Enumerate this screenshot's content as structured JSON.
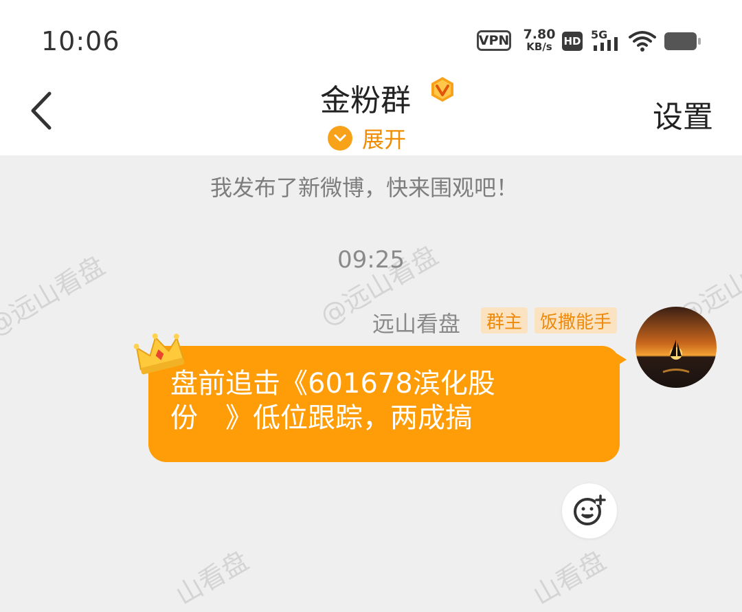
{
  "status_bar": {
    "time": "10:06",
    "vpn": "VPN",
    "net_speed_value": "7.80",
    "net_speed_unit": "KB/s",
    "hd": "HD",
    "network": "5G",
    "battery_icon": "battery-icon",
    "wifi_icon": "wifi-icon"
  },
  "header": {
    "title": "金粉群",
    "badge_icon": "v-badge-icon",
    "expand_label": "展开",
    "settings_label": "设置",
    "back_icon": "chevron-left-icon"
  },
  "chat": {
    "notice": "我发布了新微博，快来围观吧！",
    "timestamp": "09:25",
    "messages": [
      {
        "sender": "远山看盘",
        "tags": [
          "群主",
          "饭撒能手"
        ],
        "text_line1": "盘前追击《601678滨化股",
        "text_line2": "份　》低位跟踪，两成搞"
      }
    ],
    "watermark": "@远山看盘",
    "watermark_short": "山看盘"
  },
  "colors": {
    "accent": "#ff9d08",
    "tag_bg": "#fbe3c1",
    "tag_text": "#ee8a0a",
    "background": "#efefef"
  }
}
